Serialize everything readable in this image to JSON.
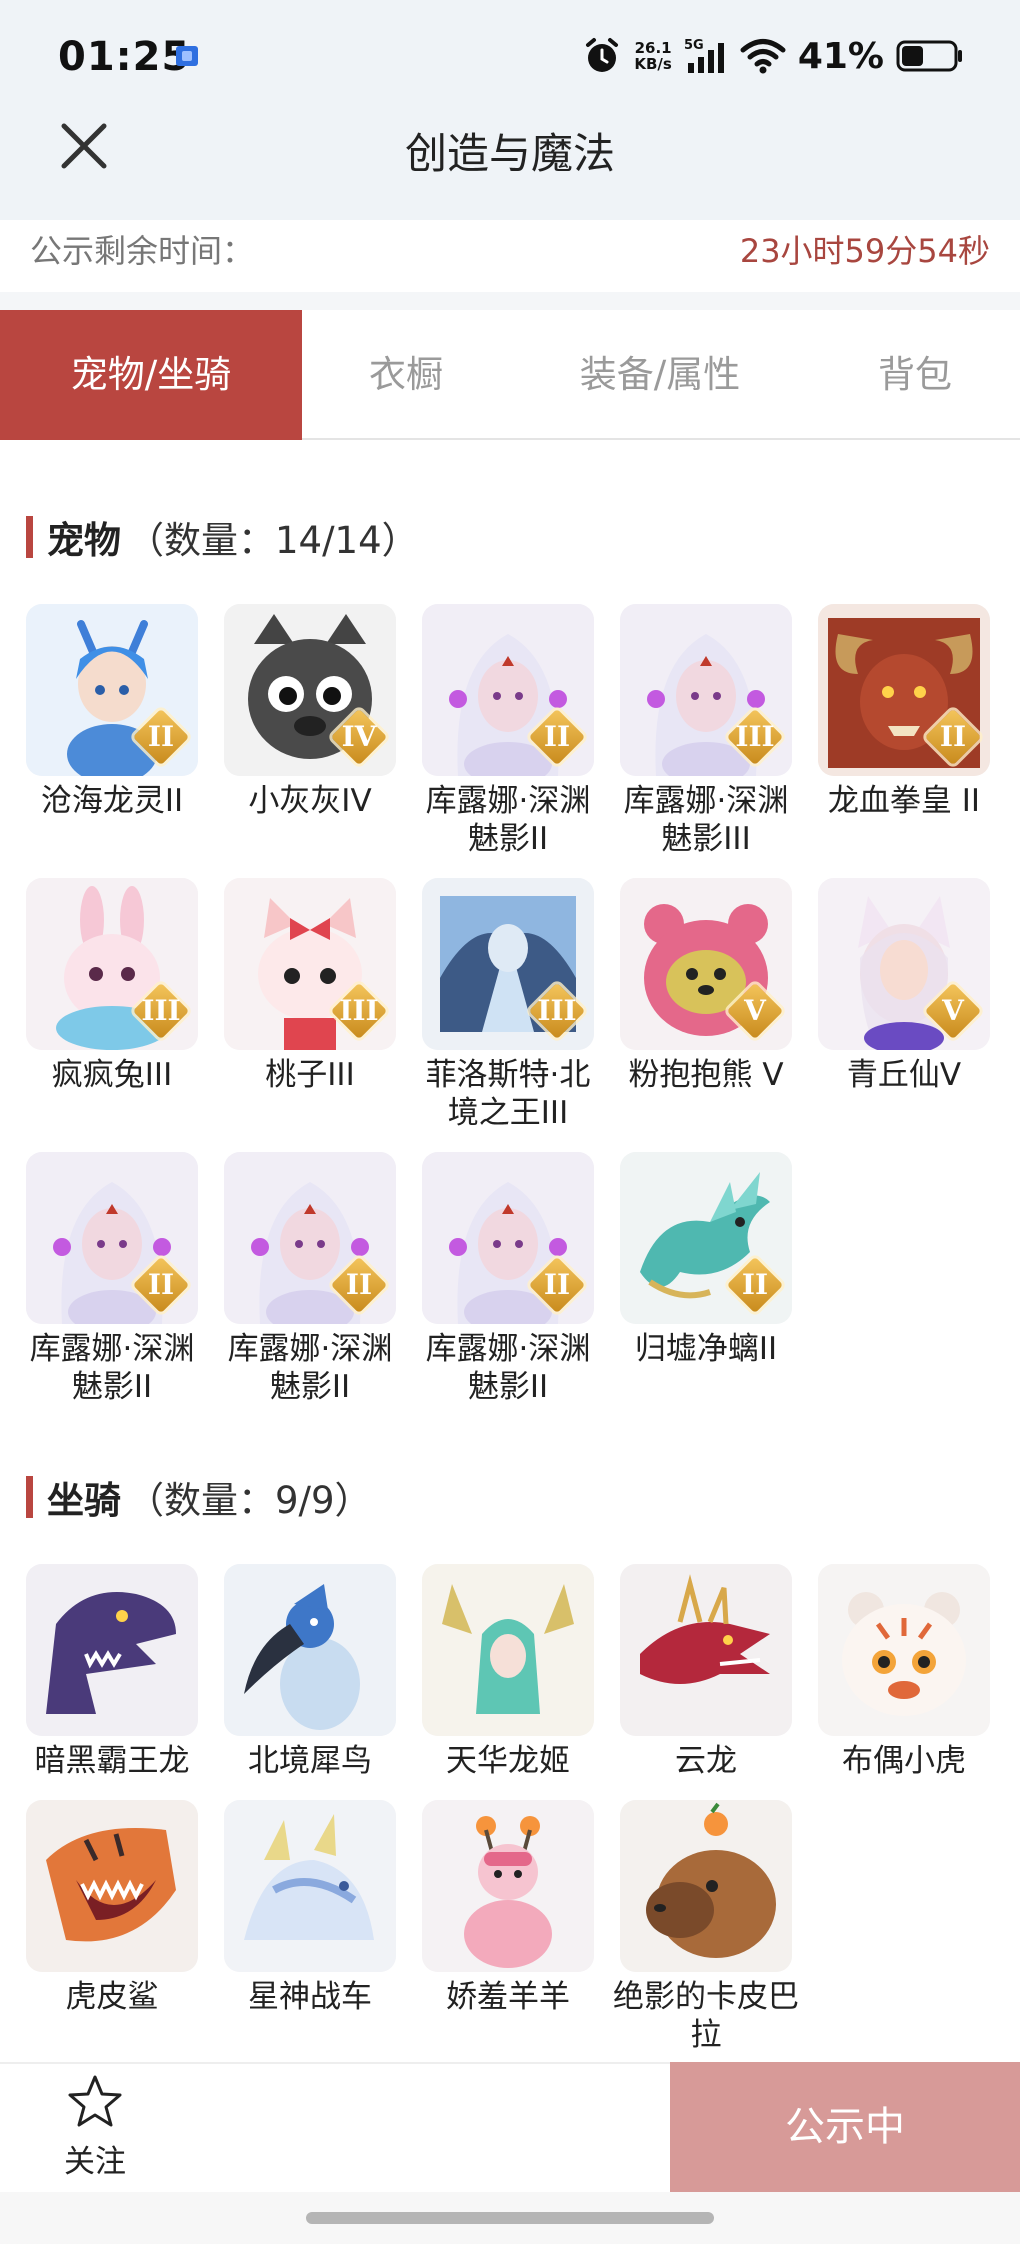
{
  "status_bar": {
    "time": "01:25",
    "net_speed_value": "26.1",
    "net_speed_unit": "KB/s",
    "network": "5G",
    "battery_percent": "41%",
    "battery_level": 0.41
  },
  "header": {
    "title": "创造与魔法",
    "close_icon": "close-icon"
  },
  "remaining": {
    "label": "公示剩余时间：",
    "value": "23小时59分54秒"
  },
  "tabs": [
    {
      "label": "宠物/坐骑",
      "active": true
    },
    {
      "label": "衣橱",
      "active": false
    },
    {
      "label": "装备/属性",
      "active": false
    },
    {
      "label": "背包",
      "active": false
    }
  ],
  "pets": {
    "title": "宠物",
    "count": "（数量：14/14）",
    "items": [
      {
        "name": "沧海龙灵II",
        "badge": "II",
        "art": "blue-dragon-spirit"
      },
      {
        "name": "小灰灰IV",
        "badge": "IV",
        "art": "grey-wolf"
      },
      {
        "name": "库露娜·深渊魅影II",
        "badge": "II",
        "art": "kuluna"
      },
      {
        "name": "库露娜·深渊魅影III",
        "badge": "III",
        "art": "kuluna"
      },
      {
        "name": "龙血拳皇 II",
        "badge": "II",
        "art": "red-beast"
      },
      {
        "name": "疯疯兔III",
        "badge": "III",
        "art": "pink-rabbit"
      },
      {
        "name": "桃子III",
        "badge": "III",
        "art": "pink-cat"
      },
      {
        "name": "菲洛斯特·北境之王III",
        "badge": "III",
        "art": "frost-knight"
      },
      {
        "name": "粉抱抱熊 V",
        "badge": "V",
        "art": "pink-bear"
      },
      {
        "name": "青丘仙V",
        "badge": "V",
        "art": "fox-fairy"
      },
      {
        "name": "库露娜·深渊魅影II",
        "badge": "II",
        "art": "kuluna"
      },
      {
        "name": "库露娜·深渊魅影II",
        "badge": "II",
        "art": "kuluna"
      },
      {
        "name": "库露娜·深渊魅影II",
        "badge": "II",
        "art": "kuluna"
      },
      {
        "name": "归墟净螭II",
        "badge": "II",
        "art": "teal-dragon"
      }
    ]
  },
  "mounts": {
    "title": "坐骑",
    "count": "（数量：9/9）",
    "items": [
      {
        "name": "暗黑霸王龙",
        "art": "purple-trex"
      },
      {
        "name": "北境犀鸟",
        "art": "hornbill"
      },
      {
        "name": "天华龙姬",
        "art": "dragon-princess"
      },
      {
        "name": "云龙",
        "art": "cloud-dragon"
      },
      {
        "name": "布偶小虎",
        "art": "plush-tiger"
      },
      {
        "name": "虎皮鲨",
        "art": "tiger-shark"
      },
      {
        "name": "星神战车",
        "art": "star-chariot"
      },
      {
        "name": "娇羞羊羊",
        "art": "shy-sheep"
      },
      {
        "name": "绝影的卡皮巴拉",
        "art": "capybara"
      }
    ]
  },
  "bottom": {
    "follow_label": "关注",
    "follow_icon": "star-outline-icon",
    "publish_label": "公示中"
  },
  "colors": {
    "accent": "#b94640",
    "publish_button": "#d79a98",
    "countdown": "#a8463f",
    "header_bg": "#eff3f7"
  }
}
